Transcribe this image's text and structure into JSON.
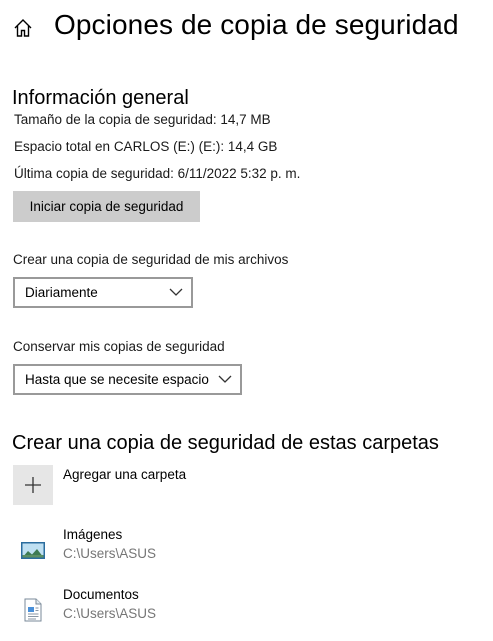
{
  "header": {
    "title": "Opciones de copia de seguridad",
    "home_icon": "home-icon"
  },
  "overview": {
    "title": "Información general",
    "size_line": "Tamaño de la copia de seguridad: 14,7 MB",
    "space_line": "Espacio total en CARLOS (E:) (E:): 14,4 GB",
    "last_line": "Última copia de seguridad: 6/11/2022 5:32 p. m.",
    "backup_button": "Iniciar copia de seguridad"
  },
  "frequency": {
    "label": "Crear una copia de seguridad de mis archivos",
    "selected": "Diariamente"
  },
  "retention": {
    "label": "Conservar mis copias de seguridad",
    "selected": "Hasta que se necesite espacio"
  },
  "folders": {
    "title": "Crear una copia de seguridad de estas carpetas",
    "add_label": "Agregar una carpeta",
    "items": [
      {
        "name": "Imágenes",
        "path": "C:\\Users\\ASUS",
        "icon": "pictures-folder-icon"
      },
      {
        "name": "Documentos",
        "path": "C:\\Users\\ASUS",
        "icon": "documents-folder-icon"
      }
    ]
  },
  "colors": {
    "button_bg": "#cccccc",
    "dropdown_border": "#999999",
    "secondary_text": "#767676"
  }
}
